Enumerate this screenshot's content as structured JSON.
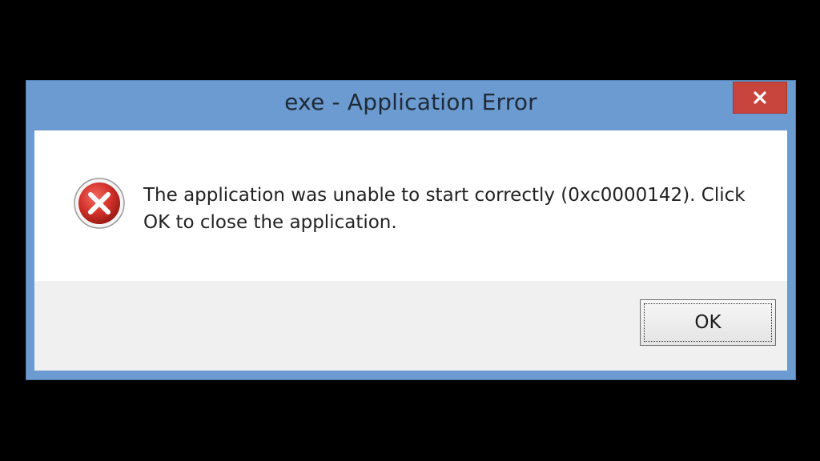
{
  "window": {
    "title": "exe - Application Error",
    "close_icon": "close-icon"
  },
  "message": {
    "icon": "error-icon",
    "text": "The application was unable to start correctly (0xc0000142). Click OK to close the application."
  },
  "buttons": {
    "ok_label": "OK"
  },
  "colors": {
    "frame": "#6b9bd0",
    "close_button": "#c8453d",
    "message_background": "#ffffff",
    "footer_background": "#f0f0f0",
    "error_icon_red": "#d2312a"
  }
}
